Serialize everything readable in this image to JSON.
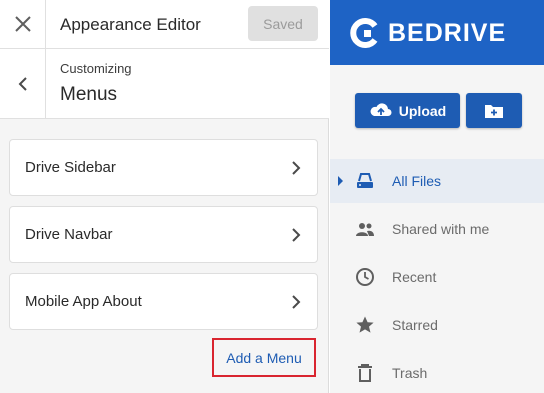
{
  "editor": {
    "title": "Appearance Editor",
    "saved_label": "Saved",
    "subheader": {
      "small": "Customizing",
      "big": "Menus"
    },
    "menus": [
      {
        "label": "Drive Sidebar"
      },
      {
        "label": "Drive Navbar"
      },
      {
        "label": "Mobile App About"
      }
    ],
    "add_menu_label": "Add a Menu"
  },
  "preview": {
    "brand": "BEDRIVE",
    "upload_label": "Upload",
    "nav": [
      {
        "label": "All Files",
        "icon": "drive-icon",
        "active": true
      },
      {
        "label": "Shared with me",
        "icon": "people-icon",
        "active": false
      },
      {
        "label": "Recent",
        "icon": "clock-icon",
        "active": false
      },
      {
        "label": "Starred",
        "icon": "star-icon",
        "active": false
      },
      {
        "label": "Trash",
        "icon": "trash-icon",
        "active": false
      }
    ]
  },
  "colors": {
    "brand_blue": "#1e63c5",
    "button_blue": "#1e5cb3",
    "highlight_red": "#d9252f"
  }
}
